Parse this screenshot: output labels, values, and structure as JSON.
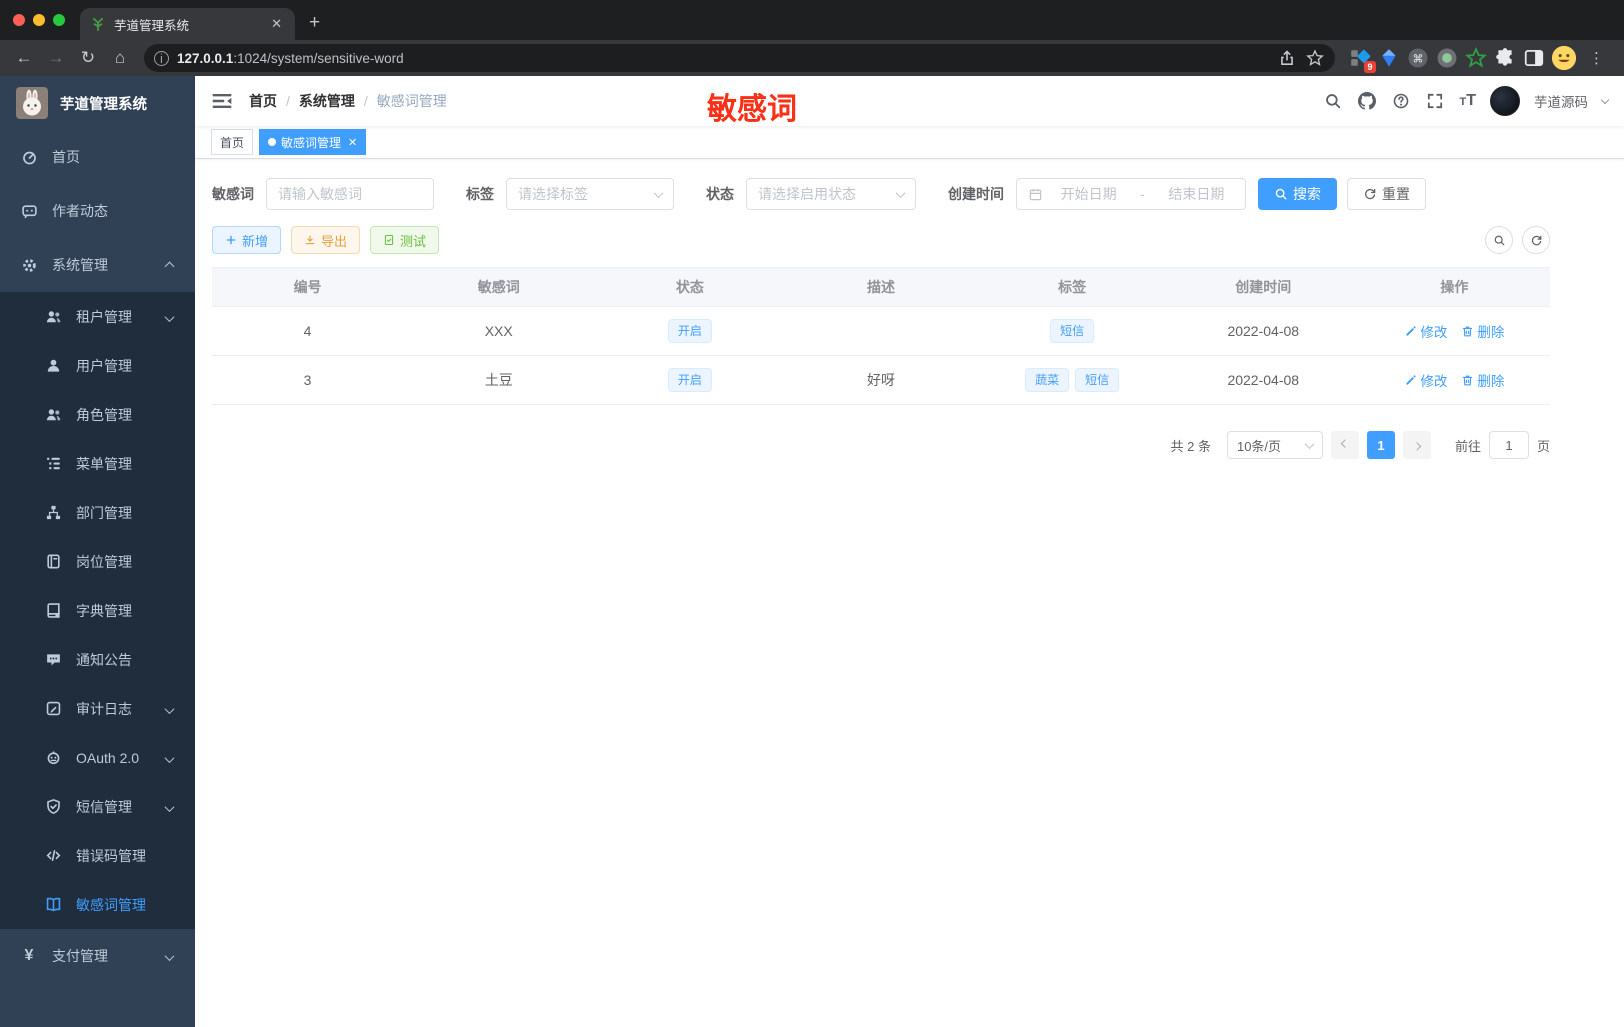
{
  "browser": {
    "tab": {
      "title": "芋道管理系统",
      "favicon": "plant-icon"
    },
    "url": {
      "host": "127.0.0.1",
      "rest": ":1024/system/sensitive-word"
    },
    "extensions_badge": "9"
  },
  "sidebar": {
    "title": "芋道管理系统",
    "items": [
      {
        "id": "home",
        "label": "首页",
        "icon": "dashboard-icon",
        "level": 1
      },
      {
        "id": "author-news",
        "label": "作者动态",
        "icon": "chat-icon",
        "level": 1
      },
      {
        "id": "system-mgmt",
        "label": "系统管理",
        "icon": "gear-icon",
        "level": 1,
        "chevron": "up"
      },
      {
        "id": "tenant-mgmt",
        "label": "租户管理",
        "icon": "users-icon",
        "level": 2,
        "chevron": "down"
      },
      {
        "id": "user-mgmt",
        "label": "用户管理",
        "icon": "user-icon",
        "level": 2
      },
      {
        "id": "role-mgmt",
        "label": "角色管理",
        "icon": "users-icon",
        "level": 2
      },
      {
        "id": "menu-mgmt",
        "label": "菜单管理",
        "icon": "menu-tree-icon",
        "level": 2
      },
      {
        "id": "dept-mgmt",
        "label": "部门管理",
        "icon": "org-icon",
        "level": 2
      },
      {
        "id": "post-mgmt",
        "label": "岗位管理",
        "icon": "badge-icon",
        "level": 2
      },
      {
        "id": "dict-mgmt",
        "label": "字典管理",
        "icon": "dictionary-icon",
        "level": 2
      },
      {
        "id": "notice",
        "label": "通知公告",
        "icon": "announcement-icon",
        "level": 2
      },
      {
        "id": "audit-log",
        "label": "审计日志",
        "icon": "log-icon",
        "level": 2,
        "chevron": "down"
      },
      {
        "id": "oauth",
        "label": "OAuth 2.0",
        "icon": "oauth-icon",
        "level": 2,
        "chevron": "down"
      },
      {
        "id": "sms-mgmt",
        "label": "短信管理",
        "icon": "shield-check-icon",
        "level": 2,
        "chevron": "down"
      },
      {
        "id": "error-code-mgmt",
        "label": "错误码管理",
        "icon": "code-icon",
        "level": 2
      },
      {
        "id": "sensitive-word",
        "label": "敏感词管理",
        "icon": "open-book-icon",
        "level": 2,
        "active": true
      },
      {
        "id": "payment-mgmt",
        "label": "支付管理",
        "icon": "yen-icon",
        "level": 1,
        "chevron": "down"
      }
    ]
  },
  "navbar": {
    "breadcrumbs": [
      {
        "label": "首页",
        "current": false
      },
      {
        "label": "系统管理",
        "current": false
      },
      {
        "label": "敏感词管理",
        "current": true
      }
    ],
    "annotation": "敏感词",
    "user": {
      "name": "芋道源码"
    }
  },
  "tags_view": [
    {
      "label": "首页",
      "active": false,
      "closable": false
    },
    {
      "label": "敏感词管理",
      "active": true,
      "closable": true
    }
  ],
  "filters": [
    {
      "label": "敏感词",
      "placeholder": "请输入敏感词"
    },
    {
      "label": "标签",
      "placeholder": "请选择标签"
    },
    {
      "label": "状态",
      "placeholder": "请选择启用状态"
    },
    {
      "label": "创建时间",
      "start_placeholder": "开始日期",
      "separator": "-",
      "end_placeholder": "结束日期"
    }
  ],
  "filter_actions": {
    "search": "搜索",
    "reset": "重置"
  },
  "toolbar": {
    "add": "新增",
    "export": "导出",
    "test": "测试"
  },
  "table": {
    "columns": [
      "编号",
      "敏感词",
      "状态",
      "描述",
      "标签",
      "创建时间",
      "操作"
    ],
    "rows": [
      {
        "id": "4",
        "word": "XXX",
        "status": "开启",
        "description": "",
        "tags": [
          "短信"
        ],
        "created": "2022-04-08"
      },
      {
        "id": "3",
        "word": "土豆",
        "status": "开启",
        "description": "好呀",
        "tags": [
          "蔬菜",
          "短信"
        ],
        "created": "2022-04-08"
      }
    ],
    "row_actions": {
      "edit": "修改",
      "delete": "删除"
    }
  },
  "pagination": {
    "total_text": "共 2 条",
    "page_size": "10条/页",
    "current_page": "1",
    "goto_label": "前往",
    "goto_value": "1",
    "page_suffix": "页"
  },
  "colors": {
    "accent": "#409eff",
    "annotation_red": "#f93015",
    "warning": "#e6a23c",
    "success": "#67c23a"
  }
}
